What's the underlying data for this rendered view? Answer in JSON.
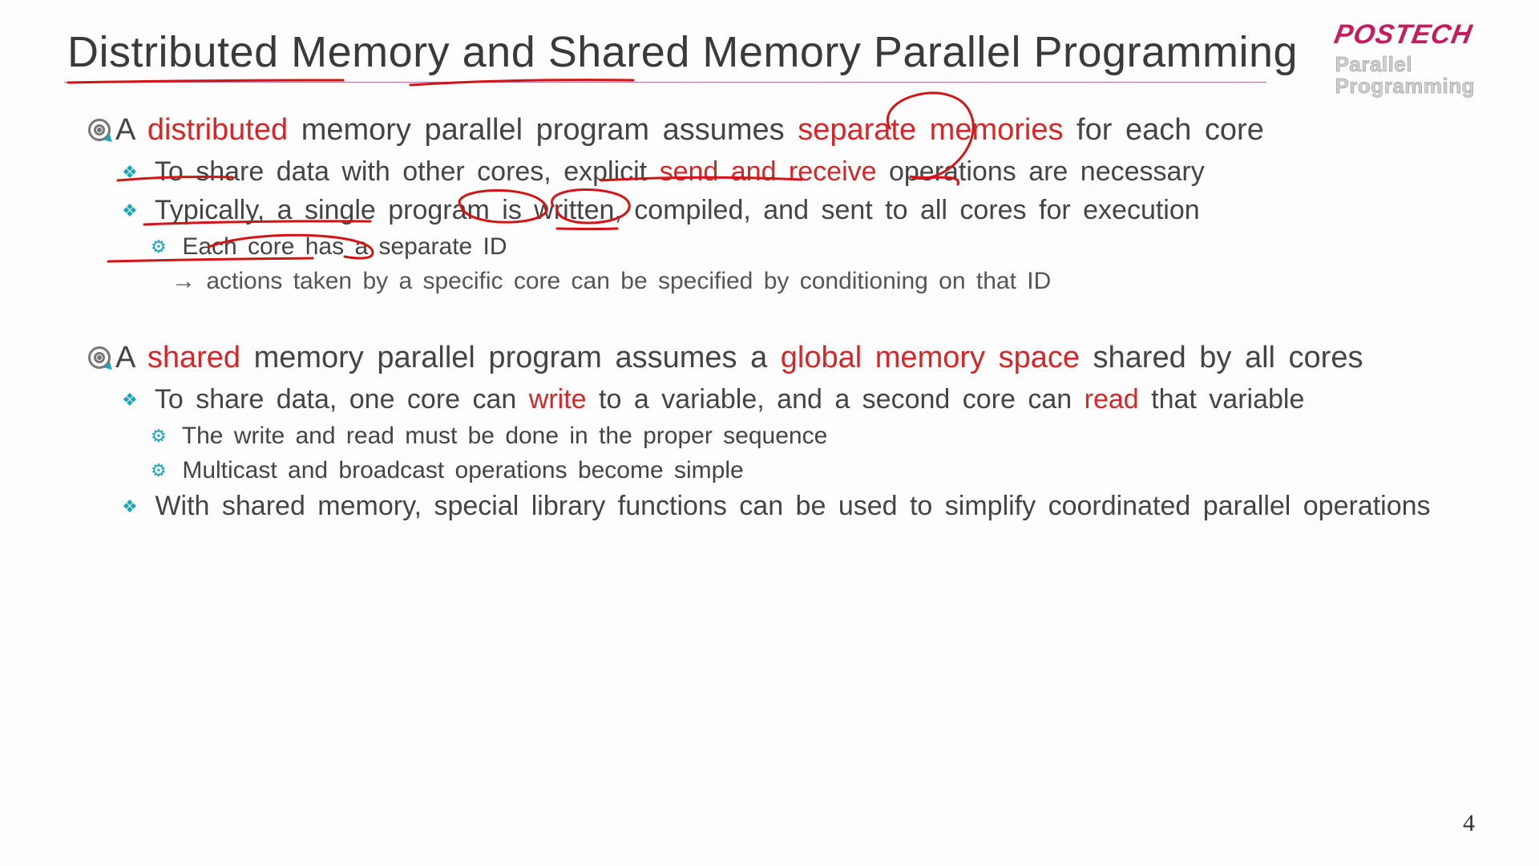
{
  "brand": {
    "main": "POSTECH",
    "sub1": "Parallel",
    "sub2": "Programming"
  },
  "title": "Distributed Memory and Shared Memory Parallel Programming",
  "page_number": "4",
  "section1": {
    "lead_a": "A ",
    "em1": "distributed ",
    "mid1": "memory parallel program assumes ",
    "em2": "separate memories",
    "mid2": " for each core",
    "sub1_a": "To share data with other cores, explicit ",
    "sub1_em": "send and receive",
    "sub1_b": " operations are necessary",
    "sub2": "Typically, a single program is written, compiled, and sent to all cores for execution",
    "sub2a": "Each core has a separate ID",
    "sub2b": "→ actions taken by a specific core can be specified by conditioning on that ID"
  },
  "section2": {
    "lead_a": "A ",
    "em1": "shared",
    "mid1": " memory parallel program assumes a ",
    "em2": "global memory space",
    "mid2": " shared by all cores",
    "sub1_a": "To share data, one core can ",
    "sub1_em1": "write",
    "sub1_b": " to a variable, and a second core can ",
    "sub1_em2": "read",
    "sub1_c": " that variable",
    "sub1a": "The write and read must be done in the proper sequence",
    "sub1b": "Multicast and broadcast operations become simple",
    "sub2": "With shared memory, special library functions can be used to simplify coordinated parallel operations"
  }
}
